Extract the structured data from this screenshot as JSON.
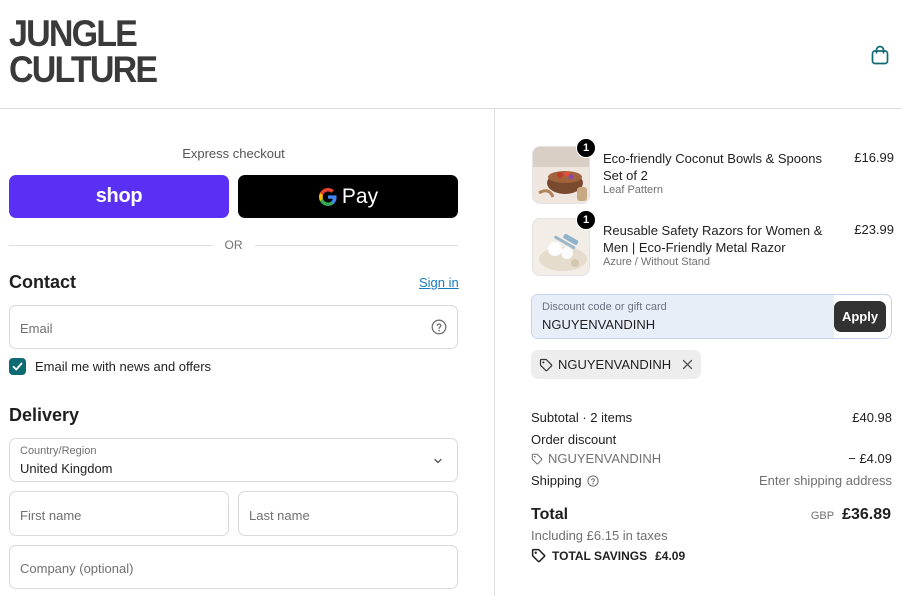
{
  "header": {
    "logo_line1": "JUNGLE",
    "logo_line2": "CULTURE",
    "cart_icon": "shopping-bag-icon"
  },
  "express": {
    "title": "Express checkout",
    "shop_label": "shop",
    "gpay_g": "G",
    "gpay_label": "Pay",
    "or_label": "OR"
  },
  "contact": {
    "title": "Contact",
    "sign_in": "Sign in",
    "email_placeholder": "Email",
    "newsletter_label": "Email me with news and offers",
    "newsletter_checked": true
  },
  "delivery": {
    "title": "Delivery",
    "country_label": "Country/Region",
    "country_value": "United Kingdom",
    "first_name_placeholder": "First name",
    "last_name_placeholder": "Last name",
    "company_placeholder": "Company (optional)"
  },
  "cart": {
    "items": [
      {
        "quantity": "1",
        "title": "Eco-friendly Coconut Bowls & Spoons Set of 2",
        "variant": "Leaf Pattern",
        "price": "£16.99"
      },
      {
        "quantity": "1",
        "title": "Reusable Safety Razors for Women & Men | Eco-Friendly Metal Razor",
        "variant": "Azure / Without Stand",
        "price": "£23.99"
      }
    ]
  },
  "discount": {
    "label": "Discount code or gift card",
    "value": "NGUYENVANDINH",
    "apply_label": "Apply",
    "applied_code": "NGUYENVANDINH"
  },
  "summary": {
    "subtotal_label": "Subtotal · 2 items",
    "subtotal_value": "£40.98",
    "order_discount_label": "Order discount",
    "discount_code": "NGUYENVANDINH",
    "discount_value": "− £4.09",
    "shipping_label": "Shipping",
    "shipping_value": "Enter shipping address",
    "total_label": "Total",
    "total_currency": "GBP",
    "total_value": "£36.89",
    "tax_line": "Including £6.15 in taxes",
    "savings_label": "TOTAL SAVINGS",
    "savings_value": "£4.09"
  },
  "colors": {
    "shop_purple": "#5a31f4",
    "accent_teal": "#0f6b73",
    "link_blue": "#197bbd"
  }
}
